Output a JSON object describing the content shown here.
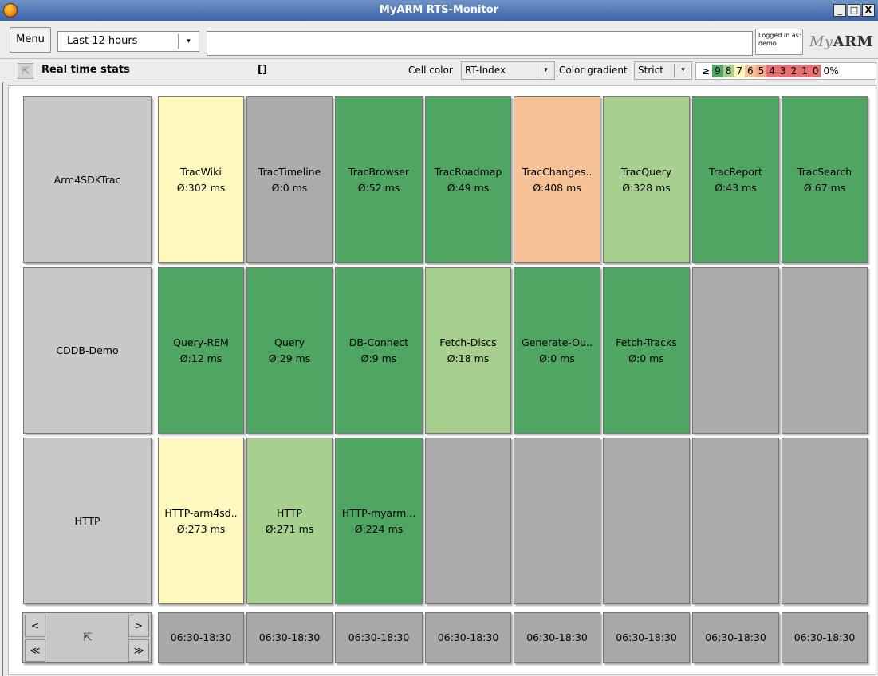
{
  "window": {
    "title": "MyARM RTS-Monitor",
    "minimize": "_",
    "maximize": "□",
    "close": "X"
  },
  "toolbar": {
    "menu_label": "Menu",
    "time_range": "Last 12 hours",
    "dropdown_arrow": "▾",
    "login_label": "Logged in as:",
    "login_user": "demo",
    "logo_my": "My",
    "logo_arm": "ARM"
  },
  "statsbar": {
    "back_icon": "⇱",
    "title": "Real time stats",
    "brackets": "[]",
    "cell_color_label": "Cell color",
    "cell_color_value": "RT-Index",
    "gradient_label": "Color gradient",
    "gradient_value": "Strict",
    "legend": [
      {
        "text": "≥",
        "color": "#ffffff"
      },
      {
        "text": "9",
        "color": "#4ea662"
      },
      {
        "text": "8",
        "color": "#a7d08e"
      },
      {
        "text": "7",
        "color": "#fdf8be"
      },
      {
        "text": "6",
        "color": "#f6c296"
      },
      {
        "text": "5",
        "color": "#f2a886"
      },
      {
        "text": "4",
        "color": "#e66f6f"
      },
      {
        "text": "3",
        "color": "#e66f6f"
      },
      {
        "text": "2",
        "color": "#e66f6f"
      },
      {
        "text": "1",
        "color": "#e66f6f"
      },
      {
        "text": "0",
        "color": "#e66f6f"
      },
      {
        "text": "0%",
        "color": "#ffffff"
      }
    ]
  },
  "rows": [
    {
      "label": "Arm4SDKTrac",
      "cells": [
        {
          "name": "TracWiki",
          "value": "Ø:302 ms",
          "level": "c7"
        },
        {
          "name": "TracTimeline",
          "value": "Ø:0 ms",
          "level": "cg"
        },
        {
          "name": "TracBrowser",
          "value": "Ø:52 ms",
          "level": "c9"
        },
        {
          "name": "TracRoadmap",
          "value": "Ø:49 ms",
          "level": "c9"
        },
        {
          "name": "TracChanges..",
          "value": "Ø:408 ms",
          "level": "c6"
        },
        {
          "name": "TracQuery",
          "value": "Ø:328 ms",
          "level": "c8"
        },
        {
          "name": "TracReport",
          "value": "Ø:43 ms",
          "level": "c9"
        },
        {
          "name": "TracSearch",
          "value": "Ø:67 ms",
          "level": "c9"
        }
      ]
    },
    {
      "label": "CDDB-Demo",
      "cells": [
        {
          "name": "Query-REM",
          "value": "Ø:12 ms",
          "level": "c9"
        },
        {
          "name": "Query",
          "value": "Ø:29 ms",
          "level": "c9"
        },
        {
          "name": "DB-Connect",
          "value": "Ø:9 ms",
          "level": "c9"
        },
        {
          "name": "Fetch-Discs",
          "value": "Ø:18 ms",
          "level": "c8"
        },
        {
          "name": "Generate-Ou..",
          "value": "Ø:0 ms",
          "level": "c9"
        },
        {
          "name": "Fetch-Tracks",
          "value": "Ø:0 ms",
          "level": "c9"
        },
        {
          "name": "",
          "value": "",
          "level": "cg"
        },
        {
          "name": "",
          "value": "",
          "level": "cg"
        }
      ]
    },
    {
      "label": "HTTP",
      "cells": [
        {
          "name": "HTTP-arm4sd..",
          "value": "Ø:273 ms",
          "level": "c7"
        },
        {
          "name": "HTTP",
          "value": "Ø:271 ms",
          "level": "c8"
        },
        {
          "name": "HTTP-myarm...",
          "value": "Ø:224 ms",
          "level": "c9"
        },
        {
          "name": "",
          "value": "",
          "level": "cg"
        },
        {
          "name": "",
          "value": "",
          "level": "cg"
        },
        {
          "name": "",
          "value": "",
          "level": "cg"
        },
        {
          "name": "",
          "value": "",
          "level": "cg"
        },
        {
          "name": "",
          "value": "",
          "level": "cg"
        }
      ]
    }
  ],
  "nav": {
    "prev": "<",
    "next": ">",
    "first": "≪",
    "last": "≫",
    "home": "⇱"
  },
  "timeslots": [
    "06:30-18:30",
    "06:30-18:30",
    "06:30-18:30",
    "06:30-18:30",
    "06:30-18:30",
    "06:30-18:30",
    "06:30-18:30",
    "06:30-18:30"
  ]
}
